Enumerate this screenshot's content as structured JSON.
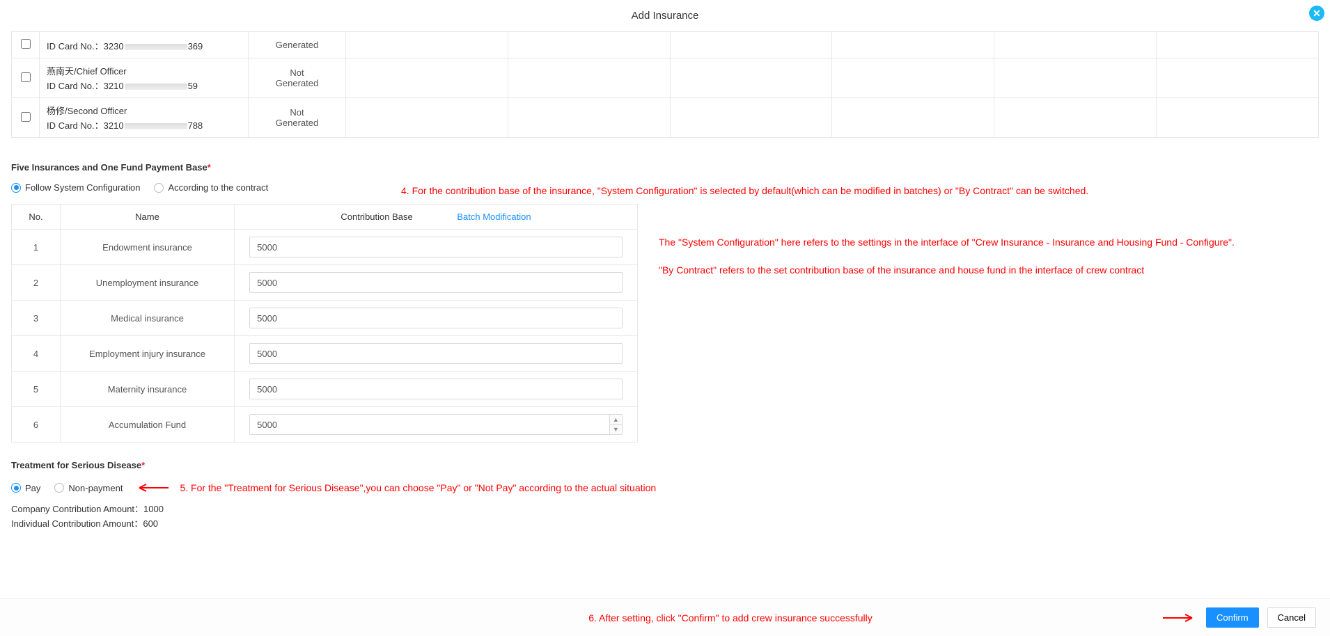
{
  "modal": {
    "title": "Add Insurance"
  },
  "crew": [
    {
      "name_role": "",
      "id_prefix": "ID Card No.：3230",
      "id_suffix": "369",
      "status_l1": "Generated",
      "status_l2": ""
    },
    {
      "name_role": "燕南天/Chief Officer",
      "id_prefix": "ID Card No.：3210",
      "id_suffix": "59",
      "status_l1": "Not",
      "status_l2": "Generated"
    },
    {
      "name_role": "杨修/Second Officer",
      "id_prefix": "ID Card No.：3210",
      "id_suffix": "788",
      "status_l1": "Not",
      "status_l2": "Generated"
    }
  ],
  "payment_base": {
    "section_title": "Five Insurances and One Fund Payment Base",
    "radio_follow": "Follow System Configuration",
    "radio_contract": "According to the contract",
    "headers": {
      "no": "No.",
      "name": "Name",
      "base": "Contribution Base",
      "batch": "Batch Modification"
    },
    "rows": [
      {
        "no": "1",
        "name": "Endowment insurance",
        "value": "5000"
      },
      {
        "no": "2",
        "name": "Unemployment insurance",
        "value": "5000"
      },
      {
        "no": "3",
        "name": "Medical insurance",
        "value": "5000"
      },
      {
        "no": "4",
        "name": "Employment injury insurance",
        "value": "5000"
      },
      {
        "no": "5",
        "name": "Maternity insurance",
        "value": "5000"
      },
      {
        "no": "6",
        "name": "Accumulation Fund",
        "value": "5000"
      }
    ]
  },
  "serious_disease": {
    "section_title": "Treatment for Serious Disease",
    "radio_pay": "Pay",
    "radio_nonpay": "Non-payment",
    "company_label": "Company Contribution Amount：",
    "company_value": "1000",
    "individual_label": "Individual Contribution Amount：",
    "individual_value": "600"
  },
  "annotations": {
    "a4": "4. For the contribution base of the insurance, \"System Configuration\" is selected by default(which can be modified in batches) or  \"By Contract\" can be switched.",
    "side1": "The \"System Configuration\" here refers to the settings in the interface of \"Crew Insurance - Insurance and Housing Fund - Configure\".",
    "side2": "\"By Contract\" refers to the set contribution base of the insurance and house fund in the interface of crew contract",
    "a5": "5. For the \"Treatment for Serious Disease\",you can choose \"Pay\" or \"Not Pay\" according to the actual situation",
    "a6": "6. After setting, click \"Confirm\" to add crew insurance successfully"
  },
  "footer": {
    "confirm": "Confirm",
    "cancel": "Cancel"
  }
}
